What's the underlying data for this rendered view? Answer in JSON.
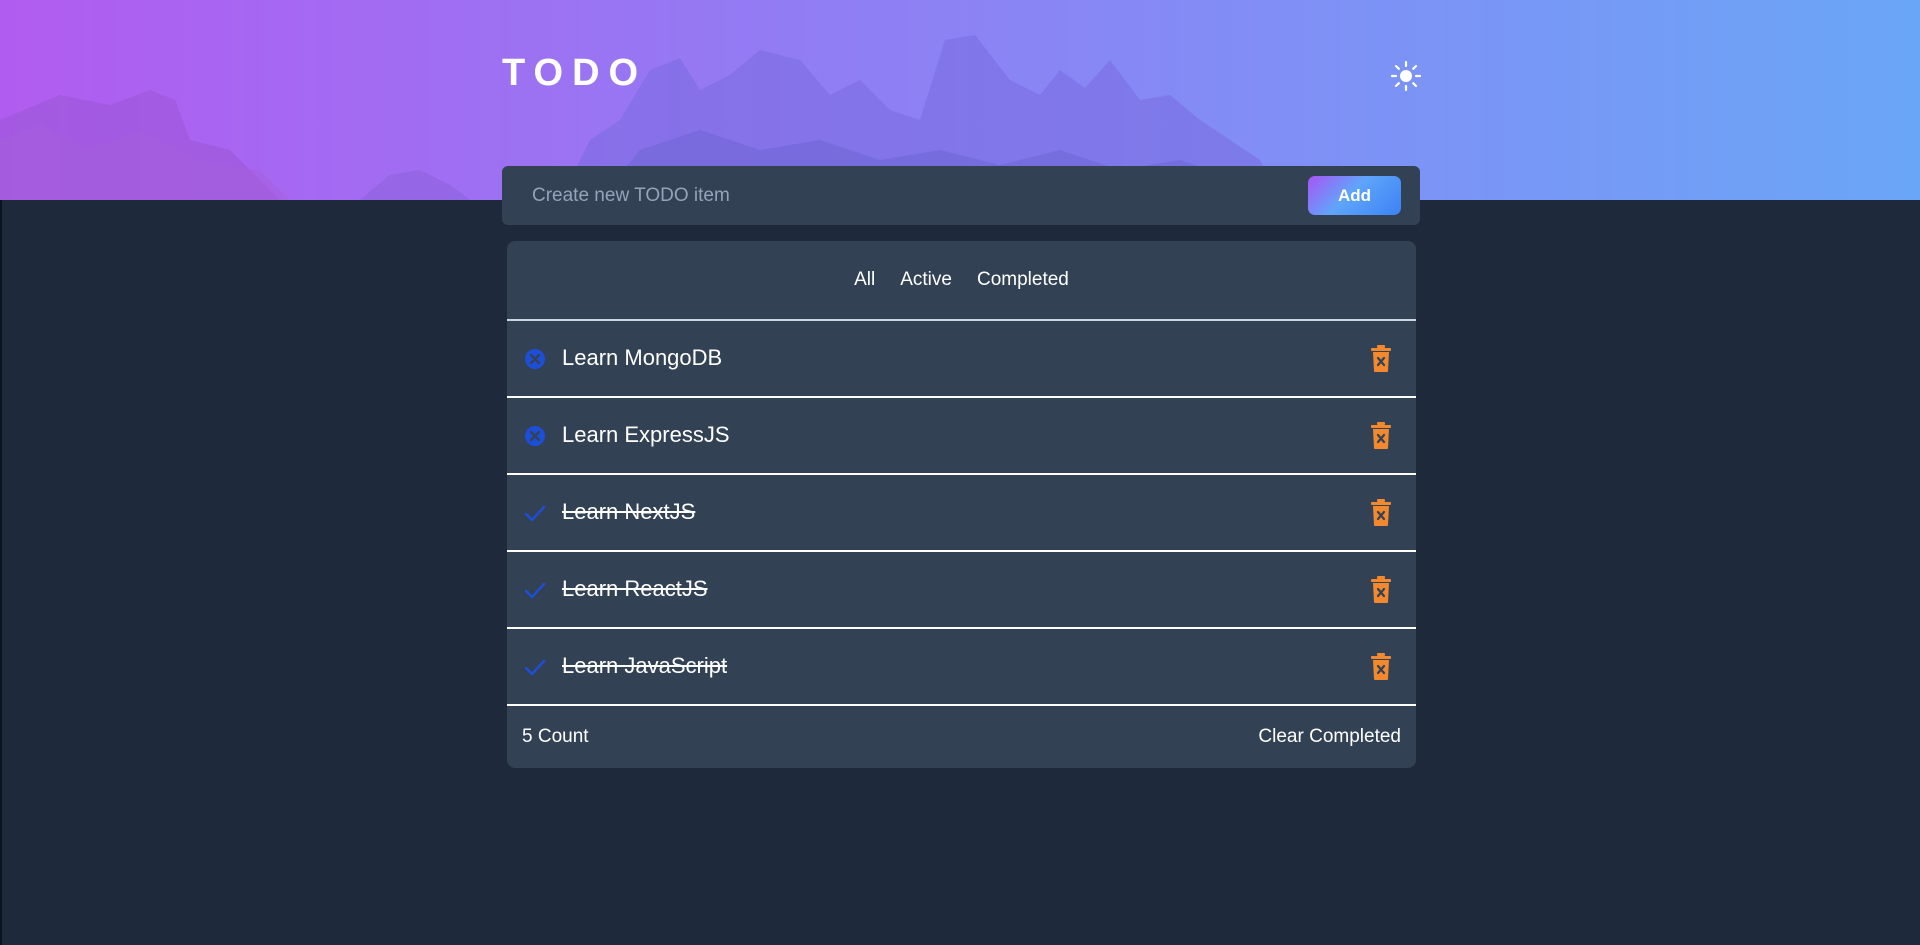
{
  "header": {
    "title": "TODO",
    "theme_icon": "sun-icon"
  },
  "new_todo": {
    "placeholder": "Create new TODO item",
    "value": "",
    "add_label": "Add"
  },
  "filters": [
    {
      "label": "All"
    },
    {
      "label": "Active"
    },
    {
      "label": "Completed"
    }
  ],
  "todos": [
    {
      "text": "Learn MongoDB",
      "completed": false,
      "status_icon": "x-circle-icon"
    },
    {
      "text": "Learn ExpressJS",
      "completed": false,
      "status_icon": "x-circle-icon"
    },
    {
      "text": "Learn NextJS",
      "completed": true,
      "status_icon": "checkmark-icon"
    },
    {
      "text": "Learn ReactJS",
      "completed": true,
      "status_icon": "checkmark-icon"
    },
    {
      "text": "Learn JavaScript",
      "completed": true,
      "status_icon": "checkmark-icon"
    }
  ],
  "footer": {
    "count": "5 Count",
    "clear_label": "Clear Completed"
  },
  "colors": {
    "page_background": "#1e293b",
    "card_background": "#334155",
    "status_icon": "#1d4ed8",
    "delete_icon": "#f2892f",
    "hero_gradient_start": "#b15cf0",
    "hero_gradient_end": "#6aa6f7"
  }
}
